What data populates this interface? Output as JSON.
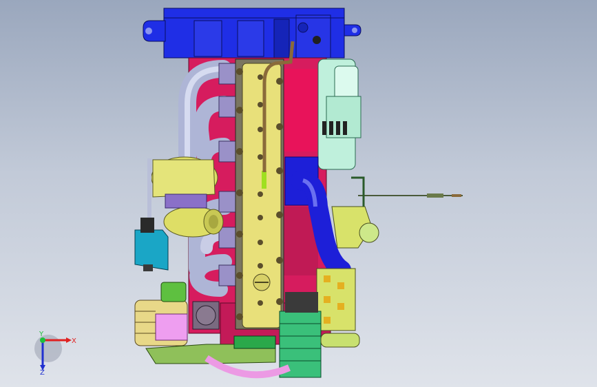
{
  "viewport": {
    "background_top": "#9aa7bd",
    "background_bottom": "#dfe3ea"
  },
  "triad": {
    "x_label": "X",
    "y_label": "Y",
    "z_label": "Z",
    "x_color": "#e02020",
    "y_color": "#1fbf3a",
    "z_color": "#2030d0"
  },
  "model": {
    "colors": {
      "flywheel_housing": "#1f2ee6",
      "cylinder_head": "#e8e07a",
      "block": "#d61c5e",
      "exhaust_manifold": "#aeb5d6",
      "turbo": "#dede66",
      "starter": "#bff0dc",
      "intake_elbow": "#1d1fd8",
      "damper": "#3ac07a",
      "fuel_pump": "#d8e26a"
    }
  }
}
